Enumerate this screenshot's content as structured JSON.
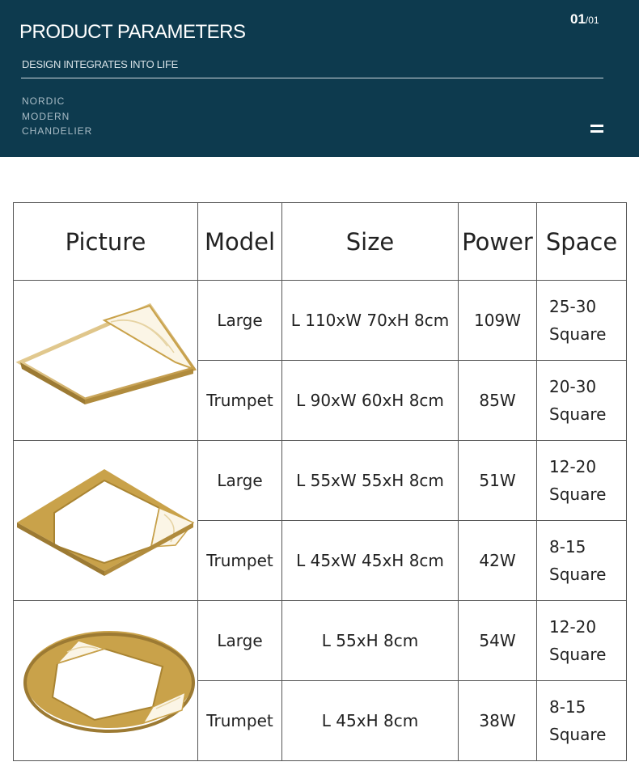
{
  "header": {
    "title": "PRODUCT PARAMETERS",
    "page_current": "01",
    "page_total": "/01",
    "subtitle": "DESIGN INTEGRATES INTO LIFE",
    "tags": [
      "NORDIC",
      "MODERN",
      "CHANDELIER"
    ],
    "menu_icon": "menu-icon"
  },
  "table": {
    "headers": [
      "Picture",
      "Model",
      "Size",
      "Power",
      "Space"
    ],
    "rows": [
      {
        "model": "Large",
        "size": "L 110xW 70xH 8cm",
        "power": "109W",
        "space": [
          "25-30",
          "Square"
        ]
      },
      {
        "model": "Trumpet",
        "size": "L 90xW 60xH 8cm",
        "power": "85W",
        "space": [
          "20-30",
          "Square"
        ]
      },
      {
        "model": "Large",
        "size": "L 55xW 55xH 8cm",
        "power": "51W",
        "space": [
          "12-20",
          "Square"
        ]
      },
      {
        "model": "Trumpet",
        "size": "L 45xW 45xH 8cm",
        "power": "42W",
        "space": [
          "8-15",
          "Square"
        ]
      },
      {
        "model": "Large",
        "size": "L 55xH 8cm",
        "power": "54W",
        "space": [
          "12-20",
          "Square"
        ]
      },
      {
        "model": "Trumpet",
        "size": "L 45xH 8cm",
        "power": "38W",
        "space": [
          "8-15",
          "Square"
        ]
      }
    ]
  },
  "colors": {
    "header_bg": "#0d3a4e",
    "gold": "#c9a24a"
  }
}
